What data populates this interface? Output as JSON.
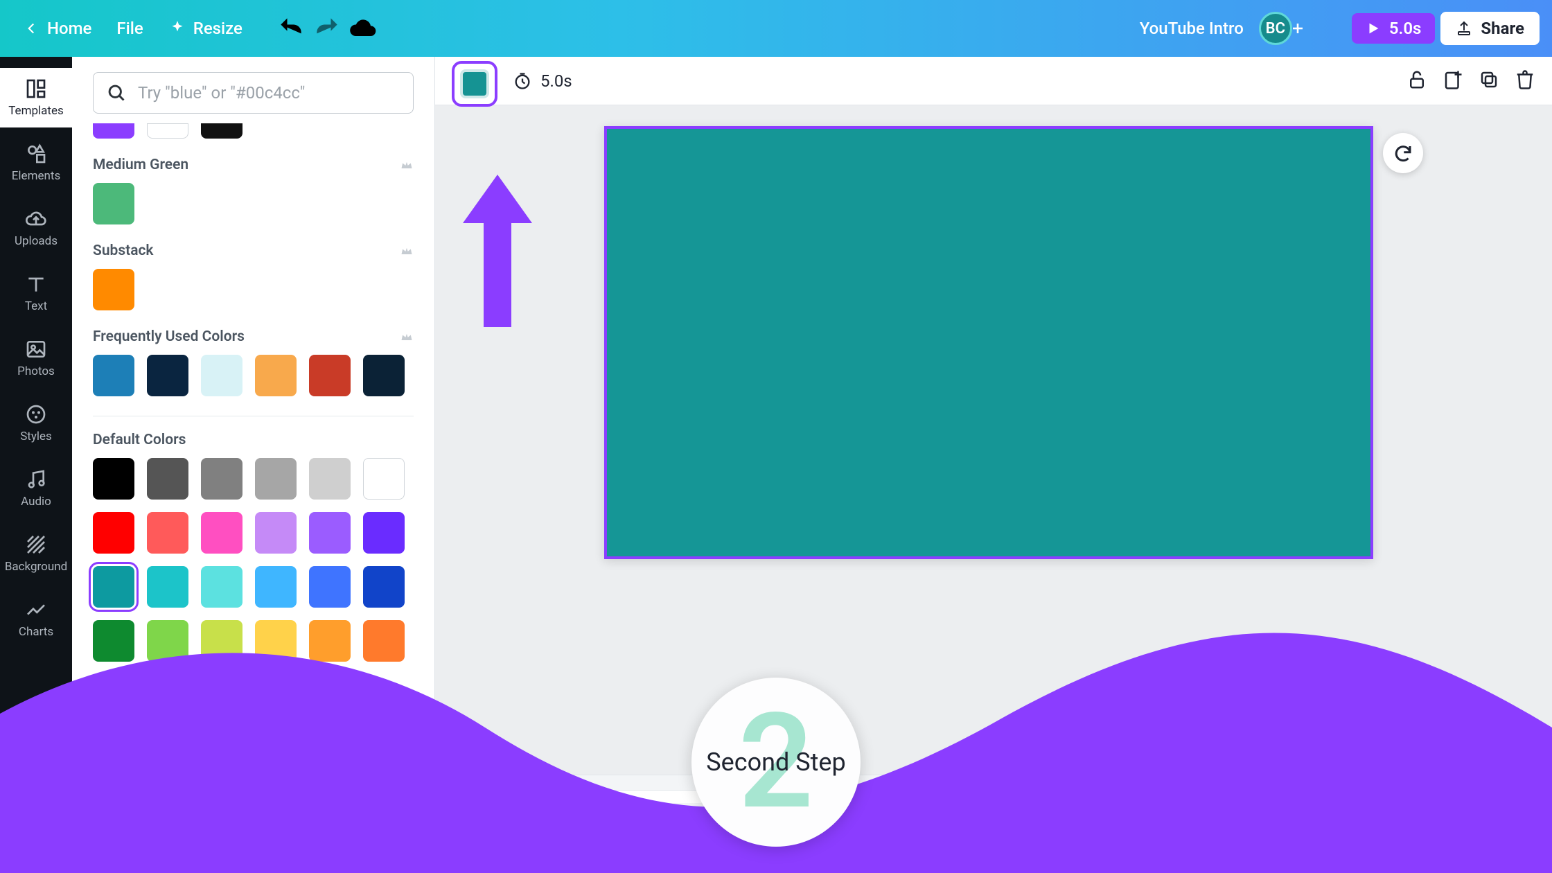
{
  "topbar": {
    "home": "Home",
    "file": "File",
    "resize": "Resize",
    "project_name": "YouTube Intro",
    "avatar": "BC",
    "play_duration": "5.0s",
    "share": "Share"
  },
  "rail": [
    {
      "id": "templates",
      "label": "Templates"
    },
    {
      "id": "elements",
      "label": "Elements"
    },
    {
      "id": "uploads",
      "label": "Uploads"
    },
    {
      "id": "text",
      "label": "Text"
    },
    {
      "id": "photos",
      "label": "Photos"
    },
    {
      "id": "styles",
      "label": "Styles"
    },
    {
      "id": "audio",
      "label": "Audio"
    },
    {
      "id": "bg",
      "label": "Background"
    },
    {
      "id": "charts",
      "label": "Charts"
    }
  ],
  "panel": {
    "search_placeholder": "Try \"blue\" or \"#00c4cc\"",
    "top_row": [
      "#8b3dff",
      "#ffffff",
      "#111111"
    ],
    "sections": {
      "medium_green": {
        "label": "Medium Green",
        "colors": [
          "#4cb97a"
        ]
      },
      "substack": {
        "label": "Substack",
        "colors": [
          "#ff8a00"
        ]
      },
      "frequent": {
        "label": "Frequently Used Colors",
        "colors": [
          "#1d7fb7",
          "#0a2540",
          "#d8f2f6",
          "#f8a94c",
          "#c93b27",
          "#0b2236"
        ]
      },
      "default": {
        "label": "Default Colors",
        "rows": [
          [
            "#000000",
            "#555555",
            "#808080",
            "#a6a6a6",
            "#cfcfcf",
            "#ffffff"
          ],
          [
            "#ff0000",
            "#ff5a5a",
            "#ff4fc1",
            "#c58af7",
            "#9b5cff",
            "#6a2cff"
          ],
          [
            "#0d9aa0",
            "#1cc4c9",
            "#5ce1e0",
            "#3fb6ff",
            "#3f74ff",
            "#1144c9"
          ],
          [
            "#0e8a2f",
            "#7fd64a",
            "#c8e04a",
            "#ffd24a",
            "#ff9e2c",
            "#ff7a2c"
          ]
        ],
        "selected_index": [
          2,
          0
        ]
      }
    }
  },
  "context": {
    "current_color": "#159393",
    "duration": "5.0s"
  },
  "canvas": {
    "bg": "#159696"
  },
  "timeline": {
    "clip_duration": "5.0s"
  },
  "annotation": {
    "step_number": "2",
    "step_label": "Second Step"
  }
}
